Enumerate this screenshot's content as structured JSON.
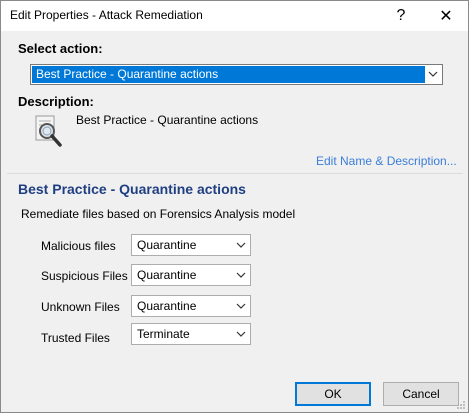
{
  "window": {
    "title": "Edit Properties - Attack Remediation",
    "help_glyph": "?",
    "close_glyph": "✕"
  },
  "select_action": {
    "label": "Select action:",
    "value": "Best Practice - Quarantine actions"
  },
  "description": {
    "label": "Description:",
    "text": "Best Practice - Quarantine actions",
    "icon": "magnifier-document-icon",
    "edit_link": "Edit Name & Description..."
  },
  "policy": {
    "title": "Best Practice - Quarantine actions",
    "subtitle": "Remediate files based on Forensics Analysis model",
    "rows": [
      {
        "label": "Malicious files",
        "value": "Quarantine"
      },
      {
        "label": "Suspicious Files",
        "value": "Quarantine"
      },
      {
        "label": "Unknown Files",
        "value": "Quarantine"
      },
      {
        "label": "Trusted Files",
        "value": "Terminate"
      }
    ]
  },
  "buttons": {
    "ok": "OK",
    "cancel": "Cancel"
  },
  "colors": {
    "accent": "#0078d7",
    "section_title": "#203f82",
    "link": "#3c7ed8",
    "dialog_bg": "#f0f0f0"
  }
}
